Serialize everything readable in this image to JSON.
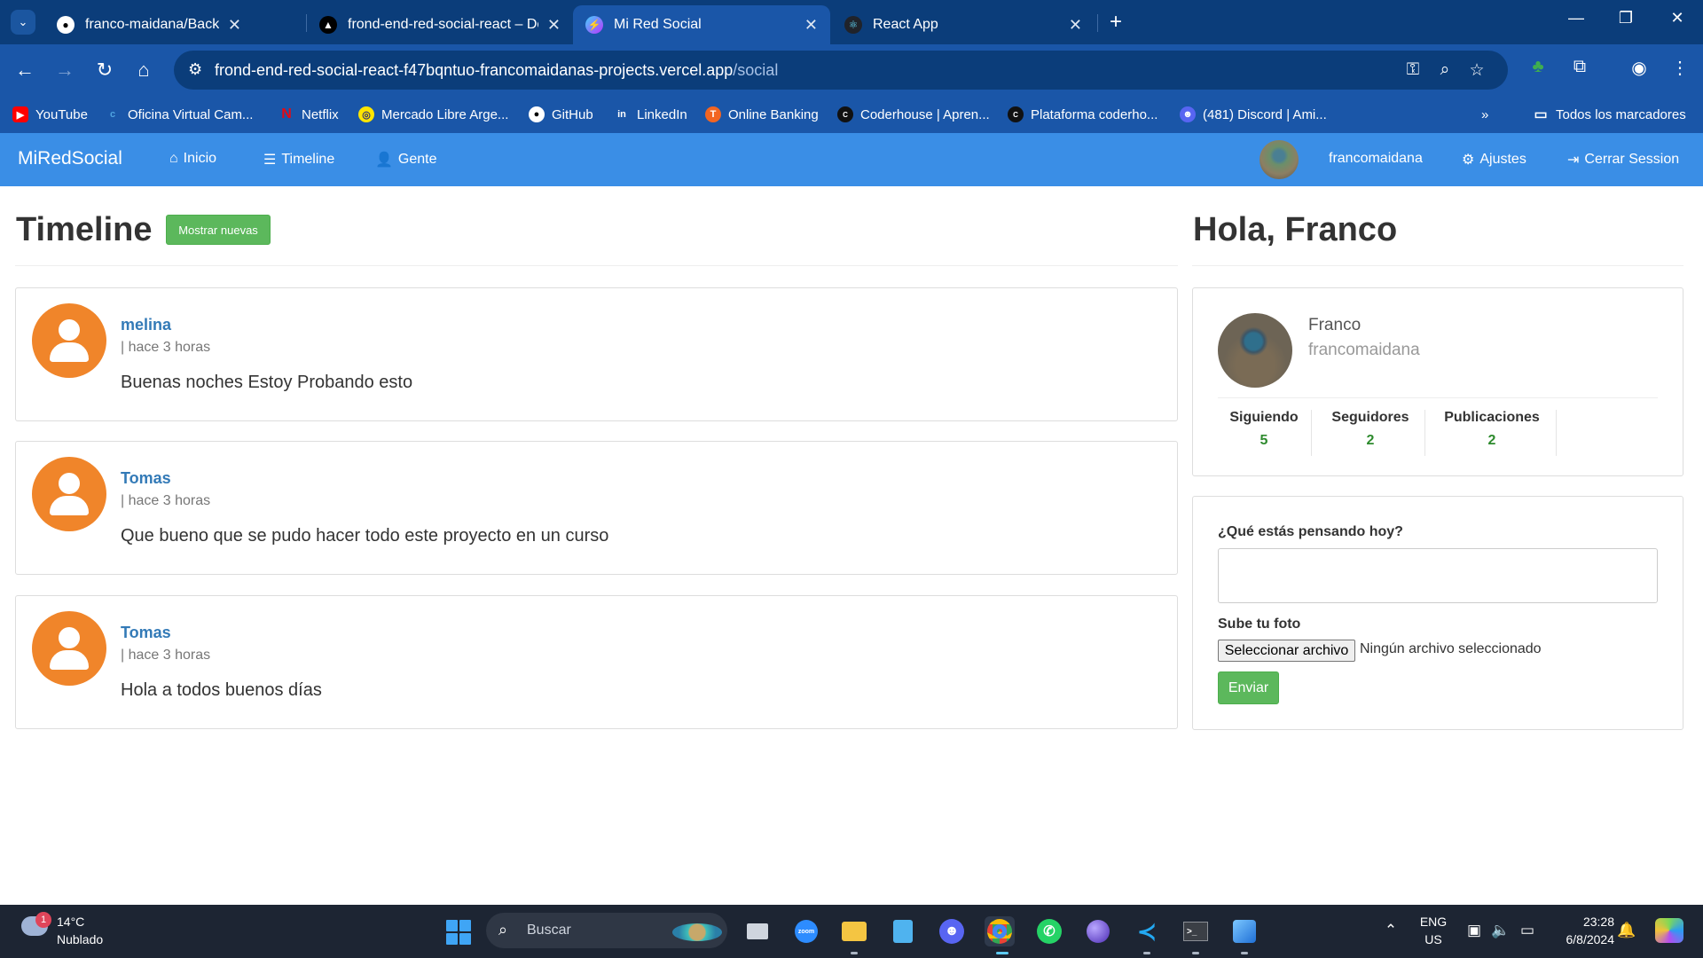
{
  "browser": {
    "tabs": [
      {
        "title": "franco-maidana/Backend-RedSo",
        "icon": "github-icon",
        "active": false
      },
      {
        "title": "frond-end-red-social-react – De",
        "icon": "vercel-icon",
        "active": false
      },
      {
        "title": "Mi Red Social",
        "icon": "vite-icon",
        "active": true
      },
      {
        "title": "React App",
        "icon": "react-icon",
        "active": false
      }
    ],
    "url_host": "frond-end-red-social-react-f47bqntuo-francomaidanas-projects.vercel.app",
    "url_path": "/social",
    "bookmarks": [
      {
        "label": "YouTube",
        "icon": "youtube-icon",
        "color": "#ff0000"
      },
      {
        "label": "Oficina Virtual Cam...",
        "icon": "oficina-icon",
        "color": "#4fa3e0"
      },
      {
        "label": "Netflix",
        "icon": "netflix-icon",
        "color": "#e50914"
      },
      {
        "label": "Mercado Libre Arge...",
        "icon": "mercadolibre-icon",
        "color": "#ffe600"
      },
      {
        "label": "GitHub",
        "icon": "github-icon",
        "color": "#ffffff"
      },
      {
        "label": "LinkedIn",
        "icon": "linkedin-icon",
        "color": "#ffffff"
      },
      {
        "label": "Online Banking",
        "icon": "bank-icon",
        "color": "#f26522"
      },
      {
        "label": "Coderhouse | Apren...",
        "icon": "coderhouse-icon",
        "color": "#111111"
      },
      {
        "label": "Plataforma coderho...",
        "icon": "coderhouse-icon",
        "color": "#111111"
      },
      {
        "label": "(481) Discord | Ami...",
        "icon": "discord-icon",
        "color": "#5865f2"
      }
    ],
    "all_bookmarks": "Todos los marcadores"
  },
  "nav": {
    "brand": "MiRedSocial",
    "inicio": "Inicio",
    "timeline": "Timeline",
    "gente": "Gente",
    "username": "francomaidana",
    "ajustes": "Ajustes",
    "logout": "Cerrar Session"
  },
  "timeline": {
    "title": "Timeline",
    "show_new": "Mostrar nuevas",
    "posts": [
      {
        "name": "melina",
        "time": "| hace 3 horas",
        "text": "Buenas noches Estoy Probando esto"
      },
      {
        "name": "Tomas",
        "time": "| hace 3 horas",
        "text": "Que bueno que se pudo hacer todo este proyecto en un curso"
      },
      {
        "name": "Tomas",
        "time": "| hace 3 horas",
        "text": "Hola a todos buenos días"
      }
    ]
  },
  "sidebar": {
    "greeting": "Hola, Franco",
    "profile": {
      "name": "Franco",
      "nick": "francomaidana"
    },
    "stats": [
      {
        "label": "Siguiendo",
        "value": "5"
      },
      {
        "label": "Seguidores",
        "value": "2"
      },
      {
        "label": "Publicaciones",
        "value": "2"
      }
    ],
    "form": {
      "question": "¿Qué estás pensando hoy?",
      "photo_label": "Sube tu foto",
      "file_button": "Seleccionar archivo",
      "file_status": "Ningún archivo seleccionado",
      "submit": "Enviar"
    }
  },
  "taskbar": {
    "temp": "14°C",
    "weather": "Nublado",
    "weather_badge": "1",
    "search": "Buscar",
    "lang1": "ENG",
    "lang2": "US",
    "time": "23:28",
    "date": "6/8/2024"
  },
  "colors": {
    "navbar": "#3a8ee6",
    "link": "#337ab7",
    "success": "#5cb85c",
    "avatar_orange": "#f0852a",
    "stat_value": "#2d8a2d"
  }
}
